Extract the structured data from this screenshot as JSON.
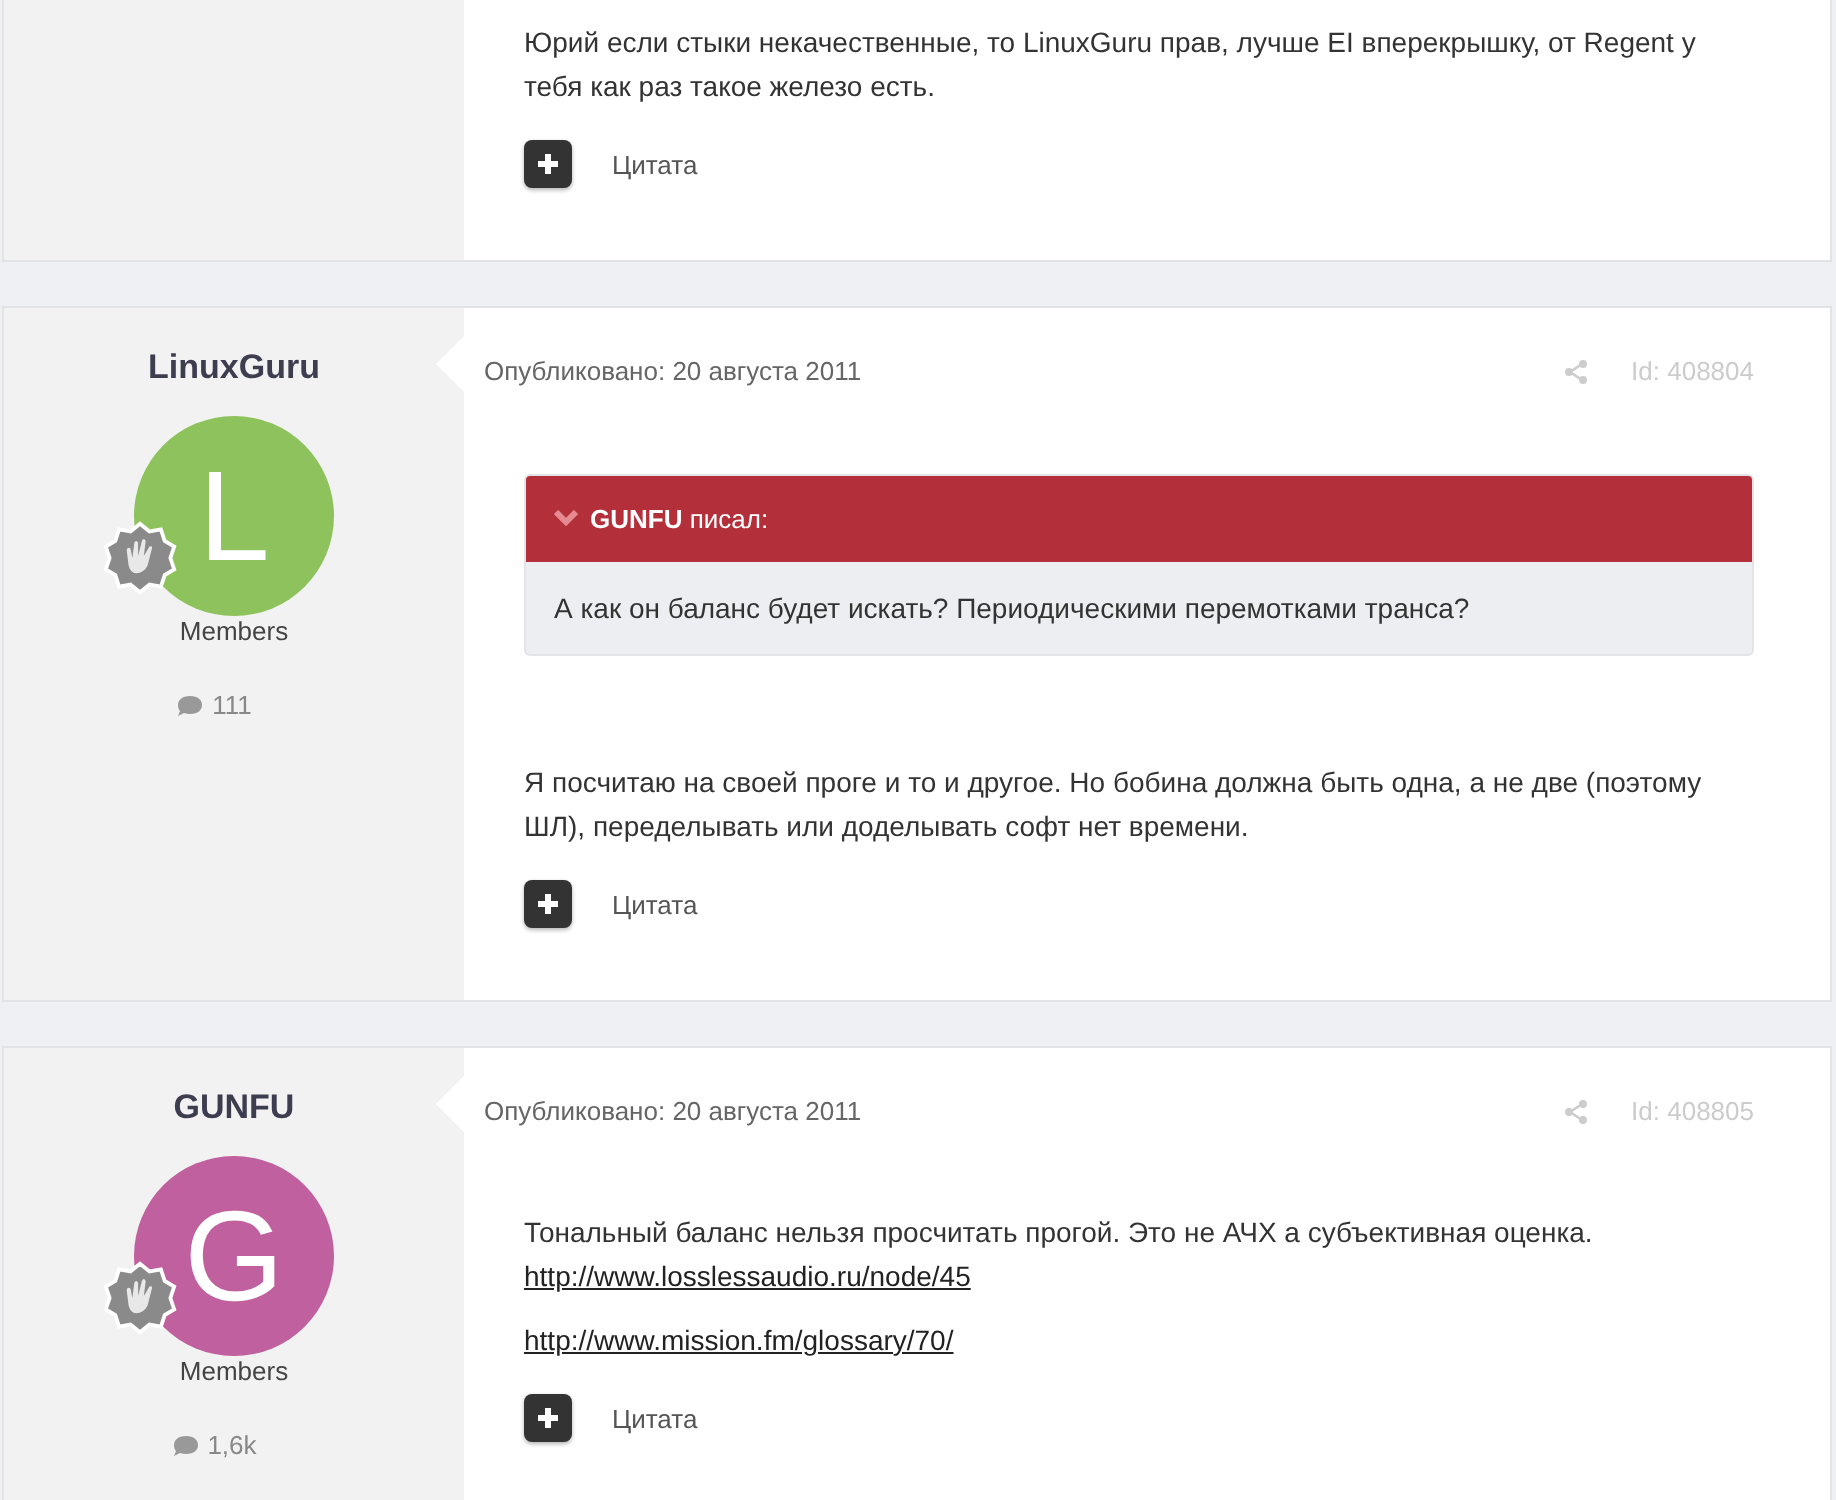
{
  "posts": [
    {
      "paragraphs": [
        [
          {
            "kind": "text",
            "text": "Юрий если стыки некачественные, то LinuxGuru прав, лучше EI вперекрышку, от Regent у тебя как раз такое железо есть."
          }
        ]
      ],
      "quote_button": "Цитата"
    },
    {
      "author": {
        "name": "LinuxGuru",
        "avatar_letter": "L",
        "color": "#8dc25c",
        "role": "Members",
        "post_count": "111"
      },
      "published": "Опубликовано: 20 августа 2011",
      "post_id": "Id: 408804",
      "quote": {
        "header": "**GUNFU** писал:",
        "text": "А как он баланс будет искать? Периодическими перемотками транса?"
      },
      "paragraphs": [
        [
          {
            "kind": "text",
            "text": "Я посчитаю на своей проге и то и другое. Но бобина должна быть одна, а не две (поэтому ШЛ), переделывать или доделывать софт нет времени."
          }
        ]
      ],
      "quote_button": "Цитата"
    },
    {
      "author": {
        "name": "GUNFU",
        "avatar_letter": "G",
        "color": "#c0609e",
        "role": "Members",
        "post_count": "1,6k"
      },
      "published": "Опубликовано: 20 августа 2011",
      "post_id": "Id: 408805",
      "paragraphs": [
        [
          {
            "kind": "text",
            "text": "Тональный баланс нельзя просчитать прогой. Это не АЧХ а субъективная оценка."
          },
          {
            "kind": "link",
            "text": "http://www.losslessaudio.ru/node/45"
          }
        ],
        [
          {
            "kind": "link",
            "text": "http://www.mission.fm/glossary/70/"
          }
        ]
      ],
      "quote_button": "Цитата"
    }
  ]
}
